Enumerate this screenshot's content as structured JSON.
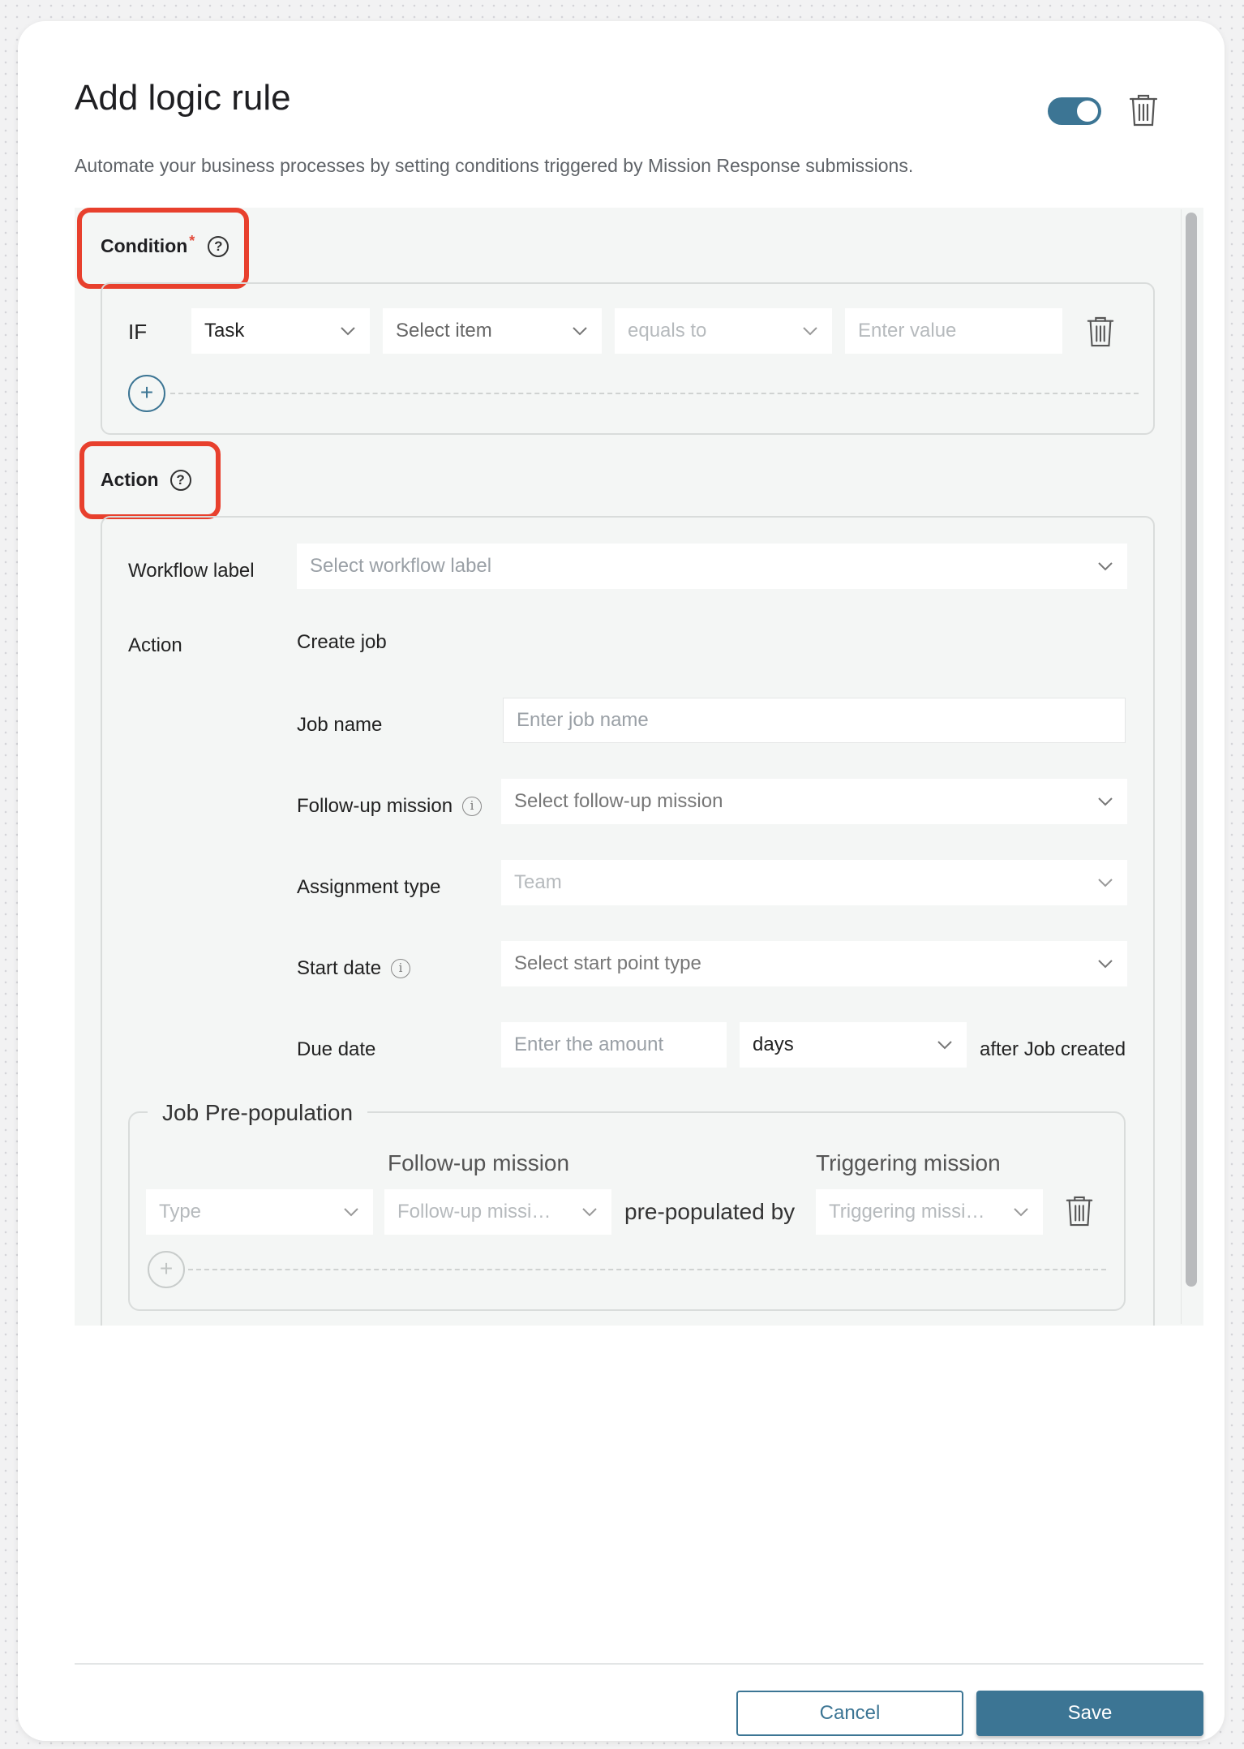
{
  "header": {
    "title": "Add logic rule",
    "subtitle": "Automate your business processes by setting conditions triggered by Mission Response submissions.",
    "toggle_on": true
  },
  "condition": {
    "label": "Condition",
    "required_mark": "*",
    "help": "?",
    "if_label": "IF",
    "field1": "Task",
    "field2_placeholder": "Select item",
    "operator": "equals to",
    "value_placeholder": "Enter value",
    "add": "+"
  },
  "action": {
    "label": "Action",
    "help": "?",
    "workflow_label": "Workflow label",
    "workflow_placeholder": "Select workflow label",
    "action_label": "Action",
    "action_value": "Create job",
    "job_name_label": "Job name",
    "job_name_placeholder": "Enter job name",
    "followup_label": "Follow-up mission",
    "followup_placeholder": "Select follow-up mission",
    "assignment_label": "Assignment type",
    "assignment_value": "Team",
    "start_date_label": "Start date",
    "start_date_placeholder": "Select start point type",
    "due_date_label": "Due date",
    "due_amount_placeholder": "Enter the amount",
    "due_unit": "days",
    "due_suffix": "after Job created",
    "info_glyph": "i"
  },
  "prepopulation": {
    "legend": "Job Pre-population",
    "col_followup": "Follow-up mission",
    "col_triggering": "Triggering mission",
    "type_placeholder": "Type",
    "followup_placeholder": "Follow-up missi…",
    "connector": "pre-populated by",
    "triggering_placeholder": "Triggering missi…",
    "add": "+"
  },
  "footer": {
    "cancel": "Cancel",
    "save": "Save"
  },
  "colors": {
    "accent": "#3c7594",
    "highlight": "#e8402d"
  }
}
